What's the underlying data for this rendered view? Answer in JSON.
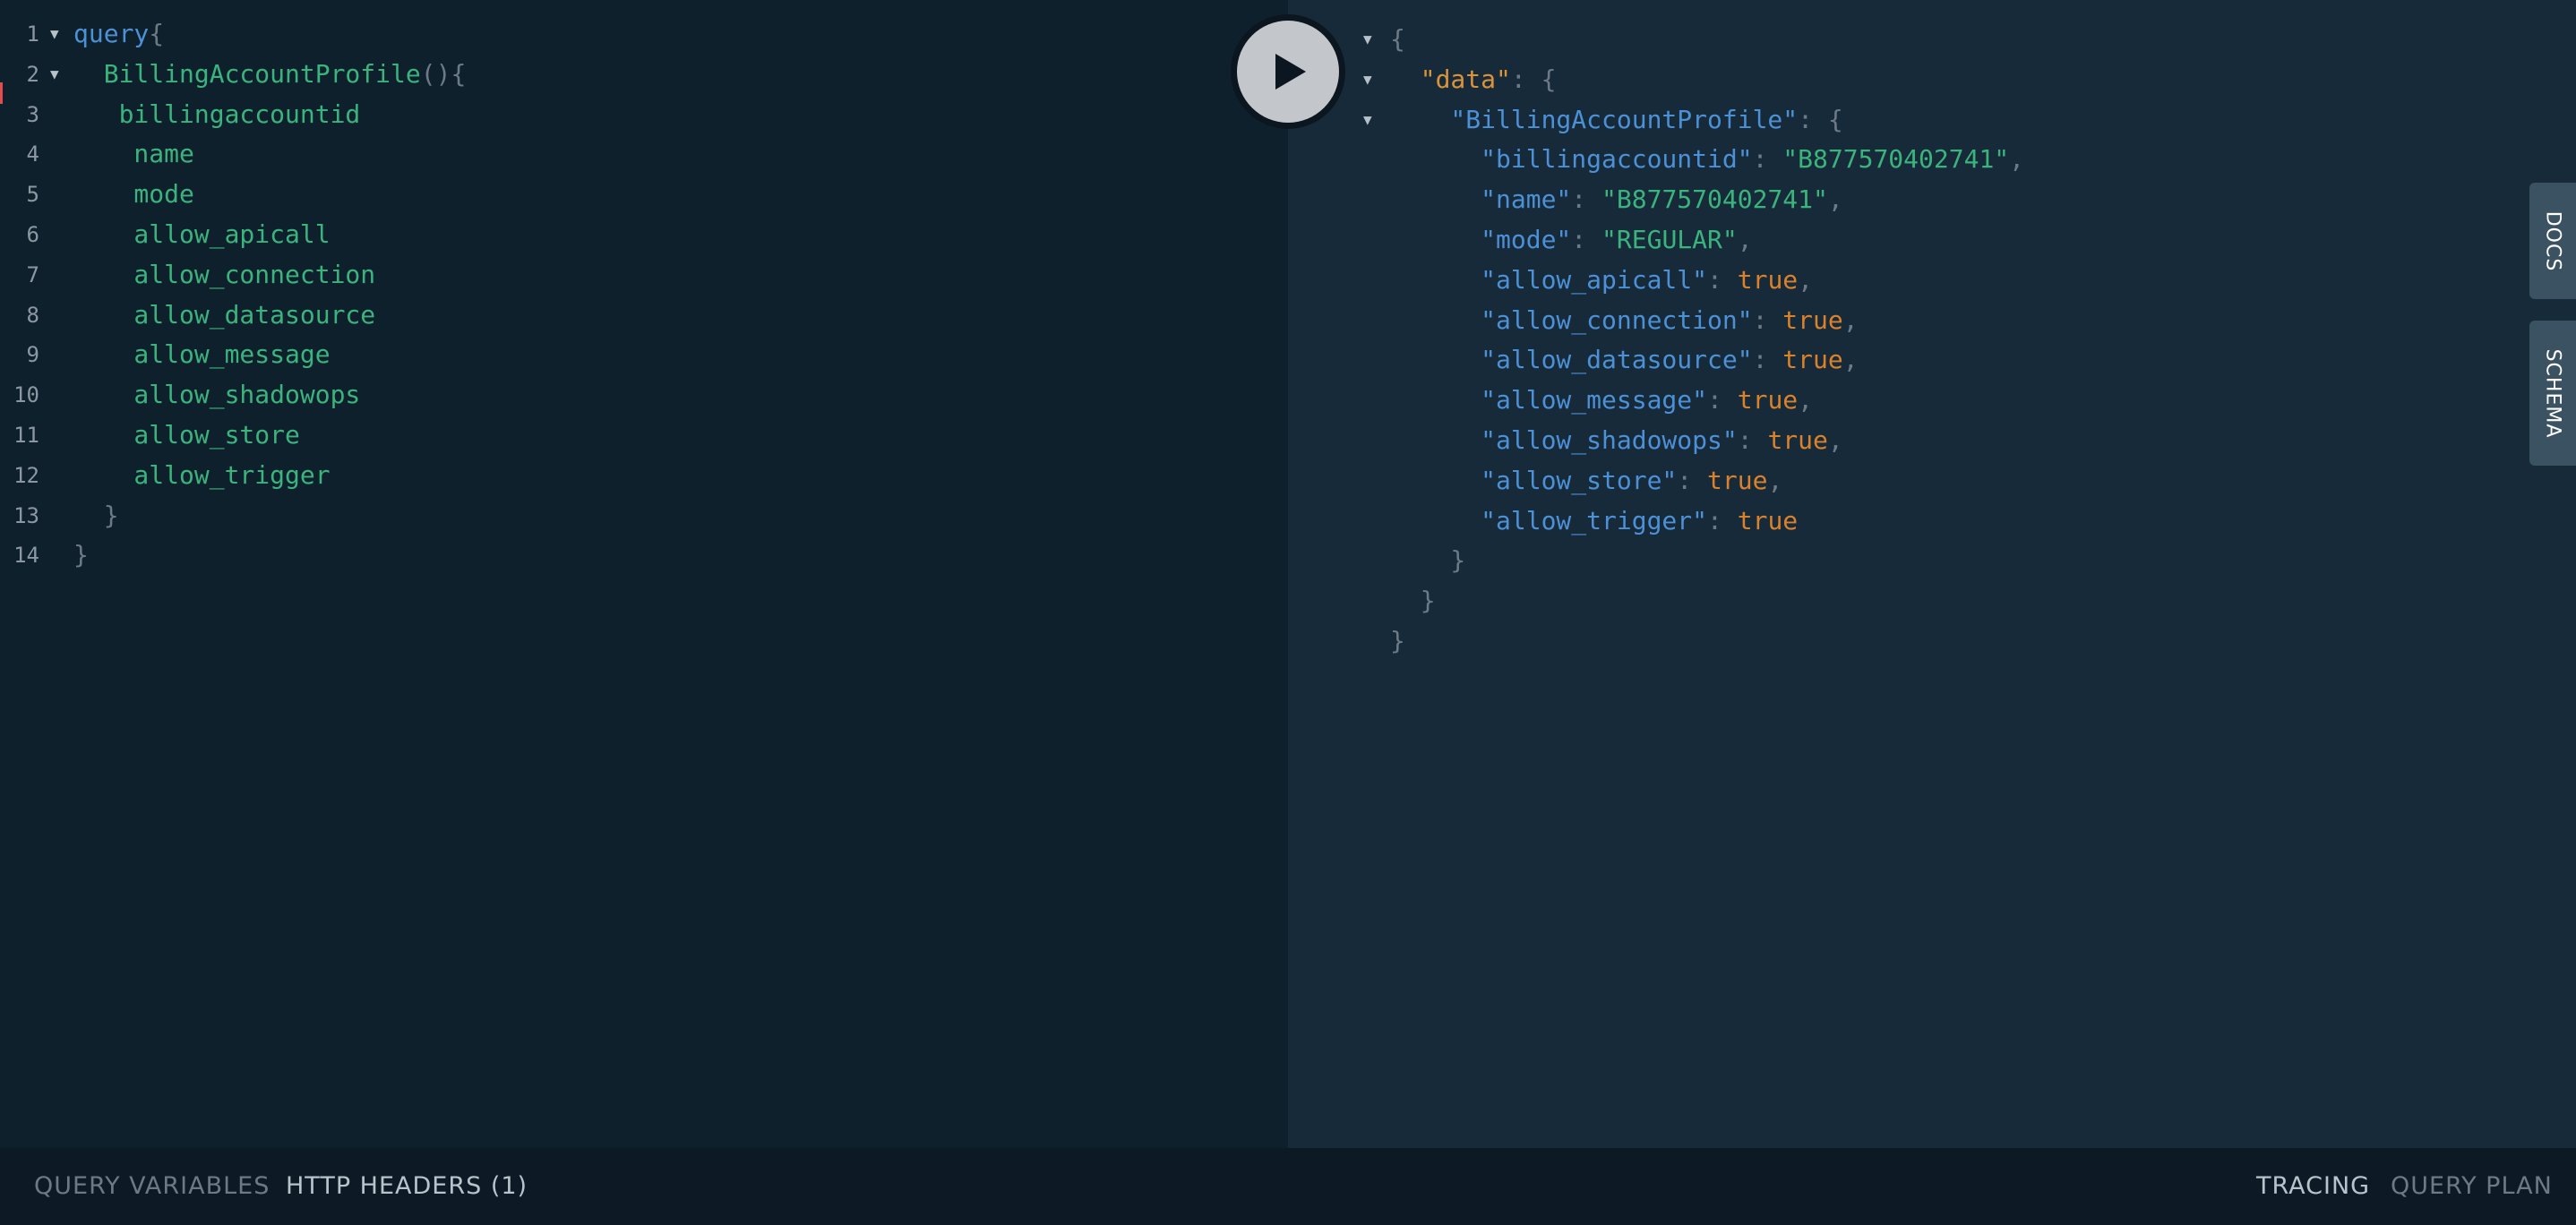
{
  "editor": {
    "lines": [
      {
        "num": "1",
        "tokens": [
          {
            "t": "query",
            "c": "kw"
          },
          {
            "t": "{",
            "c": "punc"
          }
        ]
      },
      {
        "num": "2",
        "tokens": [
          {
            "t": "  BillingAccountProfile",
            "c": "fn"
          },
          {
            "t": "(){",
            "c": "punc"
          }
        ]
      },
      {
        "num": "3",
        "tokens": [
          {
            "t": "   billingaccountid",
            "c": "fld"
          }
        ]
      },
      {
        "num": "4",
        "tokens": [
          {
            "t": "    name",
            "c": "fld"
          }
        ]
      },
      {
        "num": "5",
        "tokens": [
          {
            "t": "    mode",
            "c": "fld"
          }
        ]
      },
      {
        "num": "6",
        "tokens": [
          {
            "t": "    allow_apicall",
            "c": "fld"
          }
        ]
      },
      {
        "num": "7",
        "tokens": [
          {
            "t": "    allow_connection",
            "c": "fld"
          }
        ]
      },
      {
        "num": "8",
        "tokens": [
          {
            "t": "    allow_datasource",
            "c": "fld"
          }
        ]
      },
      {
        "num": "9",
        "tokens": [
          {
            "t": "    allow_message",
            "c": "fld"
          }
        ]
      },
      {
        "num": "10",
        "tokens": [
          {
            "t": "    allow_shadowops",
            "c": "fld"
          }
        ]
      },
      {
        "num": "11",
        "tokens": [
          {
            "t": "    allow_store",
            "c": "fld"
          }
        ]
      },
      {
        "num": "12",
        "tokens": [
          {
            "t": "    allow_trigger",
            "c": "fld"
          }
        ]
      },
      {
        "num": "13",
        "tokens": [
          {
            "t": "  }",
            "c": "punc"
          }
        ]
      },
      {
        "num": "14",
        "tokens": [
          {
            "t": "}",
            "c": "punc"
          }
        ]
      }
    ]
  },
  "result": {
    "lines": [
      {
        "tokens": [
          {
            "t": "{",
            "c": "punc"
          }
        ]
      },
      {
        "tokens": [
          {
            "t": "  \"data\"",
            "c": "keydata"
          },
          {
            "t": ": {",
            "c": "punc"
          }
        ]
      },
      {
        "tokens": [
          {
            "t": "    \"BillingAccountProfile\"",
            "c": "key"
          },
          {
            "t": ": {",
            "c": "punc"
          }
        ]
      },
      {
        "tokens": [
          {
            "t": "      \"billingaccountid\"",
            "c": "key"
          },
          {
            "t": ": ",
            "c": "punc"
          },
          {
            "t": "\"B877570402741\"",
            "c": "str"
          },
          {
            "t": ",",
            "c": "punc"
          }
        ]
      },
      {
        "tokens": [
          {
            "t": "      \"name\"",
            "c": "key"
          },
          {
            "t": ": ",
            "c": "punc"
          },
          {
            "t": "\"B877570402741\"",
            "c": "str"
          },
          {
            "t": ",",
            "c": "punc"
          }
        ]
      },
      {
        "tokens": [
          {
            "t": "      \"mode\"",
            "c": "key"
          },
          {
            "t": ": ",
            "c": "punc"
          },
          {
            "t": "\"REGULAR\"",
            "c": "str"
          },
          {
            "t": ",",
            "c": "punc"
          }
        ]
      },
      {
        "tokens": [
          {
            "t": "      \"allow_apicall\"",
            "c": "key"
          },
          {
            "t": ": ",
            "c": "punc"
          },
          {
            "t": "true",
            "c": "bool"
          },
          {
            "t": ",",
            "c": "punc"
          }
        ]
      },
      {
        "tokens": [
          {
            "t": "      \"allow_connection\"",
            "c": "key"
          },
          {
            "t": ": ",
            "c": "punc"
          },
          {
            "t": "true",
            "c": "bool"
          },
          {
            "t": ",",
            "c": "punc"
          }
        ]
      },
      {
        "tokens": [
          {
            "t": "      \"allow_datasource\"",
            "c": "key"
          },
          {
            "t": ": ",
            "c": "punc"
          },
          {
            "t": "true",
            "c": "bool"
          },
          {
            "t": ",",
            "c": "punc"
          }
        ]
      },
      {
        "tokens": [
          {
            "t": "      \"allow_message\"",
            "c": "key"
          },
          {
            "t": ": ",
            "c": "punc"
          },
          {
            "t": "true",
            "c": "bool"
          },
          {
            "t": ",",
            "c": "punc"
          }
        ]
      },
      {
        "tokens": [
          {
            "t": "      \"allow_shadowops\"",
            "c": "key"
          },
          {
            "t": ": ",
            "c": "punc"
          },
          {
            "t": "true",
            "c": "bool"
          },
          {
            "t": ",",
            "c": "punc"
          }
        ]
      },
      {
        "tokens": [
          {
            "t": "      \"allow_store\"",
            "c": "key"
          },
          {
            "t": ": ",
            "c": "punc"
          },
          {
            "t": "true",
            "c": "bool"
          },
          {
            "t": ",",
            "c": "punc"
          }
        ]
      },
      {
        "tokens": [
          {
            "t": "      \"allow_trigger\"",
            "c": "key"
          },
          {
            "t": ": ",
            "c": "punc"
          },
          {
            "t": "true",
            "c": "bool"
          }
        ]
      },
      {
        "tokens": [
          {
            "t": "    }",
            "c": "punc"
          }
        ]
      },
      {
        "tokens": [
          {
            "t": "  }",
            "c": "punc"
          }
        ]
      },
      {
        "tokens": [
          {
            "t": "}",
            "c": "punc"
          }
        ]
      }
    ]
  },
  "run_button": {
    "icon": "play-icon"
  },
  "side_tabs": {
    "docs": "DOCS",
    "schema": "SCHEMA"
  },
  "footer": {
    "query_variables": "QUERY VARIABLES",
    "http_headers": "HTTP HEADERS (1)",
    "tracing": "TRACING",
    "query_plan": "QUERY PLAN"
  },
  "colors": {
    "editor_bg": "#0f202d",
    "result_bg": "#172a3a",
    "keyword": "#4c90d6",
    "field": "#3bb37d",
    "boolean": "#d9822b",
    "data_key": "#d9943b"
  }
}
